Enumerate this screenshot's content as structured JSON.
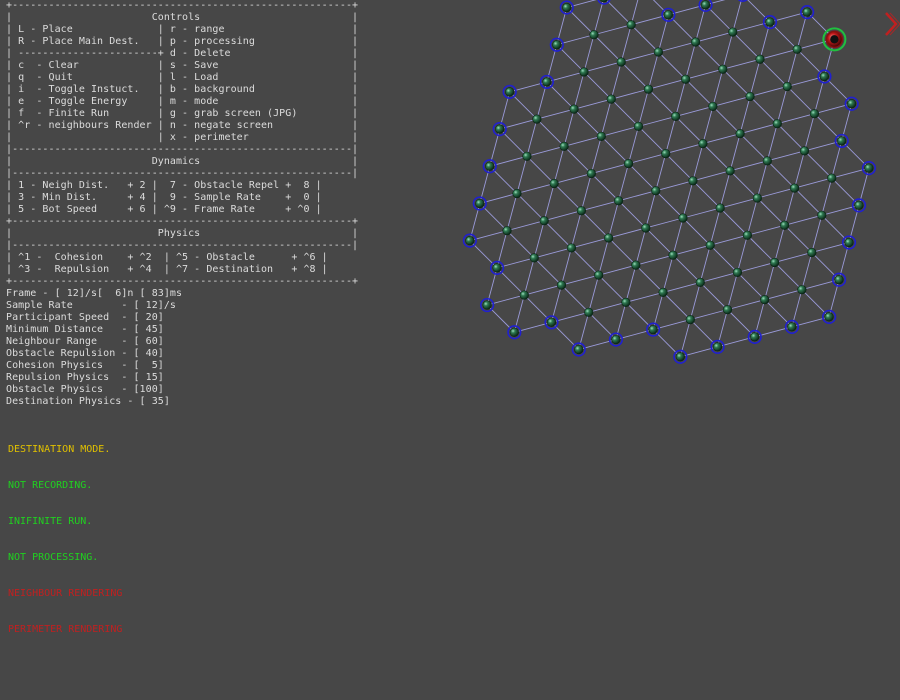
{
  "controls": {
    "border_top": "+--------------------------------------------------------+",
    "title_row": "|                       Controls                         |",
    "rows": [
      "| L - Place              | r - range                     |",
      "| R - Place Main Dest.   | p - processing                |",
      "| -----------------------+ d - Delete                    |",
      "| c  - Clear             | s - Save                      |",
      "| q  - Quit              | l - Load                      |",
      "| i  - Toggle Instuct.   | b - background                |",
      "| e  - Toggle Energy     | m - mode                      |",
      "| f  - Finite Run        | g - grab screen (JPG)         |",
      "| ^r - neighbours Render | n - negate screen             |",
      "|                        | x - perimeter                 |"
    ]
  },
  "dynamics": {
    "border_top": "|--------------------------------------------------------|",
    "title_row": "|                       Dynamics                         |",
    "border_mid": "|--------------------------------------------------------|",
    "rows": [
      "| 1 - Neigh Dist.   + 2 |  7 - Obstacle Repel +  8 |",
      "| 3 - Min Dist.     + 4 |  9 - Sample Rate    +  0 |",
      "| 5 - Bot Speed     + 6 | ^9 - Frame Rate     + ^0 |"
    ],
    "border_bottom": "+--------------------------------------------------------+"
  },
  "physics": {
    "title_row": "|                        Physics                         |",
    "border_mid": "|--------------------------------------------------------|",
    "rows": [
      "| ^1 -  Cohesion    + ^2  | ^5 - Obstacle      + ^6 |",
      "| ^3 -  Repulsion   + ^4  | ^7 - Destination   + ^8 |"
    ],
    "border_bottom": "+--------------------------------------------------------+"
  },
  "readouts": [
    "Frame - [ 12]/s[  6]n [ 83]ms",
    "Sample Rate        - [ 12]/s",
    "Participant Speed  - [ 20]",
    "Minimum Distance   - [ 45]",
    "Neighbour Range    - [ 60]",
    "Obstacle Repulsion - [ 40]",
    "Cohesion Physics   - [  5]",
    "Repulsion Physics  - [ 15]",
    "Obstacle Physics   - [100]",
    "Destination Physics - [ 35]"
  ],
  "status": [
    {
      "text": "DESTINATION MODE.",
      "color": "#e0c000"
    },
    {
      "text": "NOT RECORDING.",
      "color": "#20d020"
    },
    {
      "text": "INIFINITE RUN.",
      "color": "#20d020"
    },
    {
      "text": "NOT PROCESSING.",
      "color": "#20d020"
    },
    {
      "text": "NEIGHBOUR RENDERING",
      "color": "#c02020"
    },
    {
      "text": "PERIMETER RENDERING",
      "color": "#c02020"
    }
  ],
  "colors": {
    "background": "#474747",
    "text": "#dcdcdc",
    "edge": "#9a9ad8",
    "node_interior": "#1e5a3a",
    "node_perimeter_ring": "#2020d0",
    "selected_ring": "#20c040",
    "selected_inner": "#d02020",
    "exit_marker": "#c02020"
  },
  "icons": {
    "interior_node": "interior-node-icon",
    "perimeter_node": "perimeter-node-icon",
    "selected_node": "selected-node-icon",
    "exit_marker": "chevron-right-icon"
  }
}
